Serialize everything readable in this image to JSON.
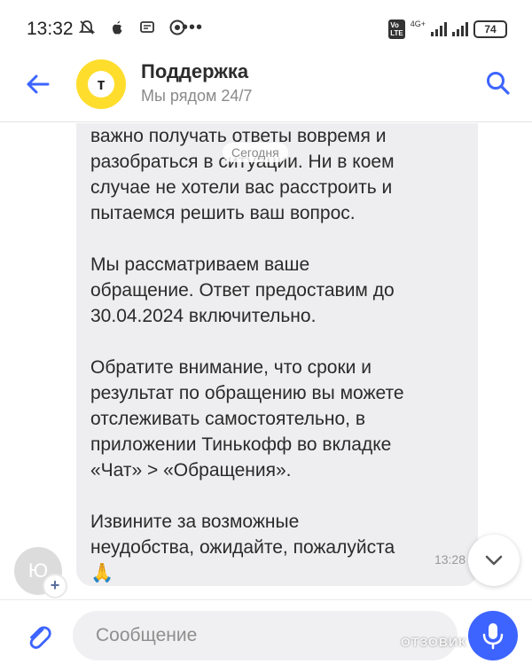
{
  "status_bar": {
    "time": "13:32",
    "network": "4G+",
    "battery": "74"
  },
  "header": {
    "title": "Поддержка",
    "subtitle": "Мы рядом 24/7",
    "avatar_letter": "т"
  },
  "chat": {
    "date_chip": "Сегодня",
    "message": {
      "text": "важно получать ответы вовремя и\nразобраться в ситуации. Ни в коем\nслучае не хотели вас расстроить и\nпытаемся решить ваш вопрос.\n\nМы рассматриваем ваше\nобращение. Ответ предоставим до\n30.04.2024 включительно.\n\nОбратите внимание, что сроки и\nрезультат по обращению вы можете\nотслеживать самостоятельно, в\nприложении Тинькофф во вкладке\n«Чат» > «Обращения».\n\nИзвините за возможные\nнеудобства, ожидайте, пожалуйста\n🙏",
      "time": "13:28"
    },
    "user_avatar_initial": "Ю",
    "user_avatar_badge": "+"
  },
  "composer": {
    "placeholder": "Сообщение",
    "watermark": "ОТЗОВИК"
  },
  "colors": {
    "brand_yellow": "#ffdd2d",
    "accent_blue": "#3d64ff",
    "bubble_bg": "#eeeef0"
  },
  "icons": {
    "back": "arrow-left-icon",
    "search": "search-icon",
    "attach": "paperclip-icon",
    "mic": "microphone-icon",
    "scroll": "chevron-down-icon"
  }
}
